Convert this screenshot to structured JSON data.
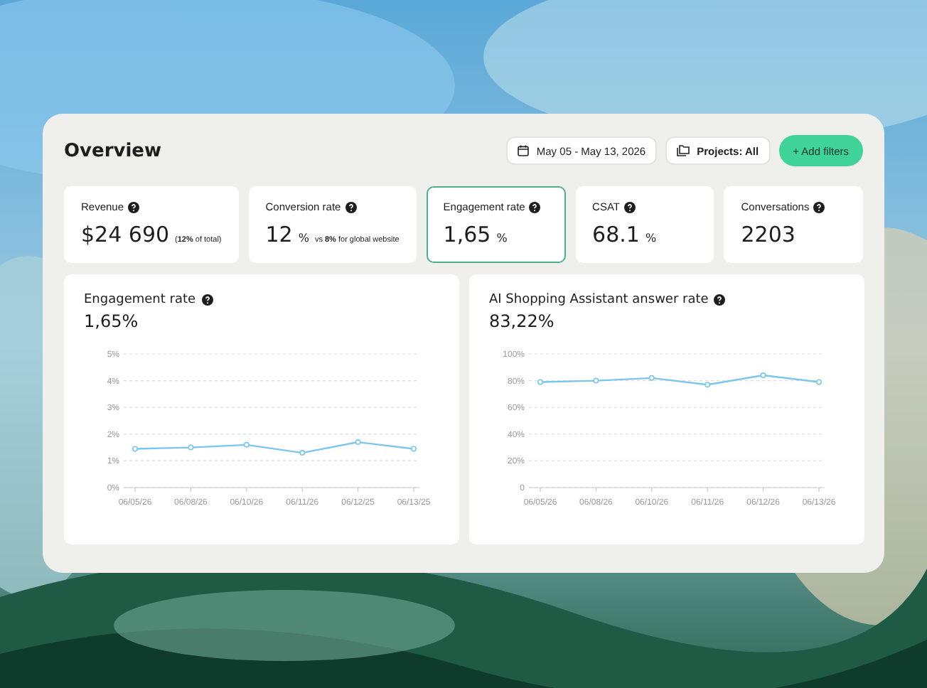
{
  "title": "Overview",
  "filters": {
    "date_range": "May 05 - May 13, 2026",
    "projects": "Projects: All",
    "add_button": "+ Add filters"
  },
  "kpis": [
    {
      "label": "Revenue",
      "value": "$24 690",
      "note": "(**12%** of total)",
      "selected": false
    },
    {
      "label": "Conversion rate",
      "value": "12",
      "unit": "%",
      "note": "vs **8%** for global website",
      "selected": false
    },
    {
      "label": "Engagement rate",
      "value": "1,65",
      "unit": "%",
      "selected": true
    },
    {
      "label": "CSAT",
      "value": "68.1",
      "unit": "%",
      "selected": false
    },
    {
      "label": "Conversations",
      "value": "2203",
      "selected": false
    }
  ],
  "charts": [
    {
      "title": "Engagement rate",
      "value": "1,65%",
      "chart_data": {
        "type": "line",
        "categories": [
          "06/05/26",
          "06/08/26",
          "06/10/26",
          "06/11/26",
          "06/12/25",
          "06/13/25"
        ],
        "ylim": [
          0,
          5
        ],
        "yticks": [
          {
            "value": 0,
            "label": "0%"
          },
          {
            "value": 1,
            "label": "1%"
          },
          {
            "value": 2,
            "label": "2%"
          },
          {
            "value": 3,
            "label": "3%"
          },
          {
            "value": 4,
            "label": "4%"
          },
          {
            "value": 5,
            "label": "5%"
          }
        ],
        "grid": true,
        "series": [
          {
            "color": "#7cc6ee",
            "marker": true,
            "values": [
              1.45,
              1.5,
              1.6,
              1.3,
              1.7,
              1.45
            ]
          }
        ]
      }
    },
    {
      "title": "AI Shopping Assistant answer rate",
      "value": "83,22%",
      "chart_data": {
        "type": "line",
        "categories": [
          "06/05/26",
          "06/08/26",
          "06/10/26",
          "06/11/26",
          "06/12/26",
          "06/13/26"
        ],
        "ylim": [
          0,
          100
        ],
        "yticks": [
          {
            "value": 0,
            "label": "0"
          },
          {
            "value": 20,
            "label": "20%"
          },
          {
            "value": 40,
            "label": "40%"
          },
          {
            "value": 60,
            "label": "60%"
          },
          {
            "value": 80,
            "label": "80%"
          },
          {
            "value": 100,
            "label": "100%"
          }
        ],
        "grid": true,
        "series": [
          {
            "color": "#7cc6ee",
            "marker": true,
            "values": [
              79,
              80,
              82,
              77,
              84,
              79
            ]
          }
        ]
      }
    }
  ]
}
